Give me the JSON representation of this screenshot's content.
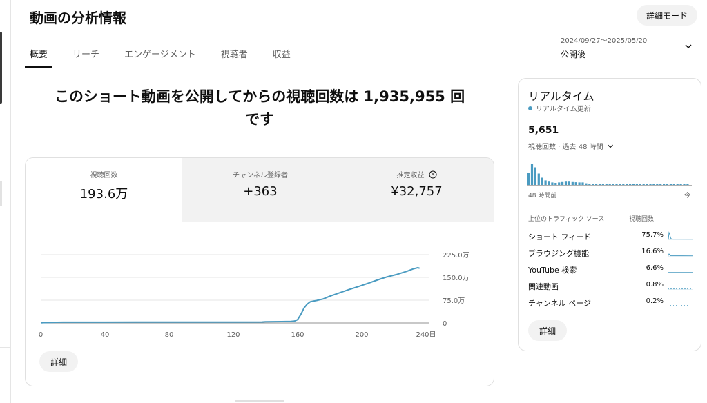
{
  "page": {
    "title": "動画の分析情報",
    "detail_mode_label": "詳細モード"
  },
  "tabs": [
    {
      "label": "概要",
      "active": true
    },
    {
      "label": "リーチ",
      "active": false
    },
    {
      "label": "エンゲージメント",
      "active": false
    },
    {
      "label": "視聴者",
      "active": false
    },
    {
      "label": "収益",
      "active": false
    }
  ],
  "date_range": {
    "dates": "2024/09/27～2025/05/20",
    "period": "公開後"
  },
  "headline": {
    "line1": "このショート動画を公開してからの視聴回数は 1,935,955 回",
    "line2": "です"
  },
  "metrics": [
    {
      "label": "視聴回数",
      "value": "193.6万"
    },
    {
      "label": "チャンネル登録者",
      "value": "+363"
    },
    {
      "label": "推定収益",
      "value": "¥32,757",
      "icon": "clock-icon"
    }
  ],
  "overview_detail_label": "詳細",
  "chart_data": {
    "type": "line",
    "x_unit": "日",
    "x_ticks": [
      "0",
      "40",
      "80",
      "120",
      "160",
      "200",
      "240日"
    ],
    "y_ticks": [
      "0",
      "75.0万",
      "150.0万",
      "225.0万"
    ],
    "xlim": [
      0,
      240
    ],
    "ylim": [
      0,
      2250000
    ],
    "grid": true,
    "color": "#4a9bc1",
    "series": [
      {
        "x": [
          0,
          2,
          6,
          10,
          14,
          20,
          30,
          40,
          60,
          80,
          100,
          120,
          138,
          140,
          150,
          156,
          158,
          160,
          162,
          164,
          166,
          168,
          172,
          176,
          180,
          186,
          192,
          198,
          204,
          210,
          216,
          222,
          228,
          232,
          235,
          236
        ],
        "y": [
          5000,
          12000,
          18000,
          22000,
          24000,
          25000,
          25500,
          26000,
          27000,
          28000,
          29000,
          30000,
          31000,
          42000,
          46000,
          52000,
          62000,
          110000,
          280000,
          490000,
          620000,
          700000,
          740000,
          790000,
          880000,
          990000,
          1100000,
          1200000,
          1310000,
          1420000,
          1520000,
          1600000,
          1700000,
          1780000,
          1820000,
          1800000
        ]
      }
    ]
  },
  "realtime": {
    "title": "リアルタイム",
    "live_label": "リアルタイム更新",
    "count": "5,651",
    "sub_label": "視聴回数 · 過去 48 時間",
    "axis_left": "48 時間前",
    "axis_right": "今",
    "bars": [
      0.6,
      1.0,
      0.85,
      0.55,
      0.35,
      0.22,
      0.16,
      0.12,
      0.1,
      0.12,
      0.14,
      0.16,
      0.16,
      0.14,
      0.13,
      0.12,
      0.12,
      0.08,
      0.04,
      0.03,
      0.03,
      0.03,
      0.02,
      0.02,
      0.02,
      0.02,
      0.02,
      0.03,
      0.02,
      0.02,
      0.02,
      0.02,
      0.02,
      0.02,
      0.02,
      0.02,
      0.02,
      0.02,
      0.02,
      0.02,
      0.02,
      0.02,
      0.02,
      0.02,
      0.02,
      0.02,
      0.02,
      0.02
    ],
    "traffic_header_source": "上位のトラフィック ソース",
    "traffic_header_views": "視聴回数",
    "traffic": [
      {
        "source": "ショート フィード",
        "percent": "75.7%"
      },
      {
        "source": "ブラウジング機能",
        "percent": "16.6%"
      },
      {
        "source": "YouTube 検索",
        "percent": "6.6%"
      },
      {
        "source": "関連動画",
        "percent": "0.8%"
      },
      {
        "source": "チャンネル ページ",
        "percent": "0.2%"
      }
    ],
    "detail_label": "詳細"
  }
}
